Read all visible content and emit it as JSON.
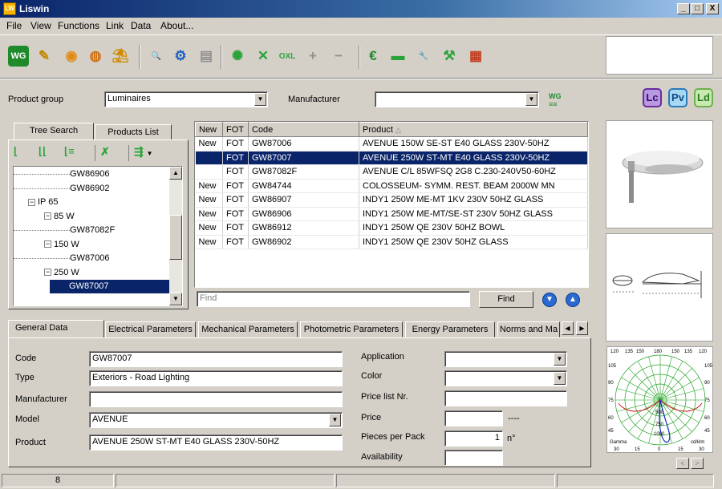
{
  "app": {
    "title": "Liswin",
    "icon_text": "LW"
  },
  "window_buttons": {
    "minimize": "_",
    "maximize": "□",
    "close": "X"
  },
  "menu": [
    "File",
    "View",
    "Functions",
    "Link",
    "Data",
    "About..."
  ],
  "toolbar": [
    {
      "name": "wg-icon",
      "glyph": "WG",
      "color": "#1f8a2a"
    },
    {
      "name": "wand-icon",
      "glyph": "✎",
      "color": "#c08a00"
    },
    {
      "name": "globe-icon",
      "glyph": "◉",
      "color": "#e08a10"
    },
    {
      "name": "globe-search-icon",
      "glyph": "◍",
      "color": "#d07010"
    },
    {
      "name": "presenter-icon",
      "glyph": "⛱",
      "color": "#d08a00"
    },
    {
      "name": "search-icon",
      "glyph": "🔍",
      "color": "#1f5fbf"
    },
    {
      "name": "settings-search-icon",
      "glyph": "⚙",
      "color": "#1f5fbf"
    },
    {
      "name": "document-icon",
      "glyph": "▤",
      "color": "#909090"
    },
    {
      "name": "gear-list-icon",
      "glyph": "✺",
      "color": "#2aa33a"
    },
    {
      "name": "cross-list-icon",
      "glyph": "✕",
      "color": "#2aa33a"
    },
    {
      "name": "oxl-icon",
      "glyph": "OXL",
      "color": "#2aa33a"
    },
    {
      "name": "plus-list-icon",
      "glyph": "+",
      "color": "#909090"
    },
    {
      "name": "minus-list-icon",
      "glyph": "−",
      "color": "#909090"
    },
    {
      "name": "euro-icon",
      "glyph": "€",
      "color": "#1f8a2a"
    },
    {
      "name": "money-icon",
      "glyph": "▬",
      "color": "#2aa33a"
    },
    {
      "name": "wrench-icon",
      "glyph": "🔧",
      "color": "#2aa33a"
    },
    {
      "name": "tools-icon",
      "glyph": "⚒",
      "color": "#2aa33a"
    },
    {
      "name": "abacus-icon",
      "glyph": "▦",
      "color": "#c04020"
    }
  ],
  "filters": {
    "product_group_label": "Product group",
    "product_group_value": "Luminaires",
    "manufacturer_label": "Manufacturer",
    "manufacturer_value": ""
  },
  "badges": {
    "lc": "Lc",
    "pv": "Pv",
    "ld": "Ld"
  },
  "left_tabs": {
    "tree_search": "Tree Search",
    "products_list": "Products List"
  },
  "tree": [
    {
      "indent": 0,
      "text": "GW86906",
      "expander": ""
    },
    {
      "indent": 0,
      "text": "GW86902",
      "expander": ""
    },
    {
      "indent": 1,
      "text": "IP 65",
      "expander": "−"
    },
    {
      "indent": 2,
      "text": "85 W",
      "expander": "−"
    },
    {
      "indent": 3,
      "text": "GW87082F",
      "expander": ""
    },
    {
      "indent": 2,
      "text": "150 W",
      "expander": "−"
    },
    {
      "indent": 3,
      "text": "GW87006",
      "expander": ""
    },
    {
      "indent": 2,
      "text": "250 W",
      "expander": "−"
    },
    {
      "indent": 3,
      "text": "GW87007",
      "expander": "",
      "selected": true
    }
  ],
  "grid": {
    "columns": [
      "New",
      "FOT",
      "Code",
      "Product"
    ],
    "rows": [
      {
        "new": "New",
        "fot": "FOT",
        "code": "GW87006",
        "product": "AVENUE 150W SE-ST E40 GLASS 230V-50HZ"
      },
      {
        "new": "",
        "fot": "FOT",
        "code": "GW87007",
        "product": "AVENUE 250W ST-MT E40 GLASS 230V-50HZ",
        "selected": true
      },
      {
        "new": "",
        "fot": "FOT",
        "code": "GW87082F",
        "product": "AVENUE C/L 85WFSQ 2G8 C.230-240V50-60HZ"
      },
      {
        "new": "New",
        "fot": "FOT",
        "code": "GW84744",
        "product": "COLOSSEUM- SYMM. REST. BEAM 2000W MN"
      },
      {
        "new": "New",
        "fot": "FOT",
        "code": "GW86907",
        "product": "INDY1 250W ME-MT 1KV 230V 50HZ GLASS"
      },
      {
        "new": "New",
        "fot": "FOT",
        "code": "GW86906",
        "product": "INDY1 250W ME-MT/SE-ST 230V 50HZ GLASS"
      },
      {
        "new": "New",
        "fot": "FOT",
        "code": "GW86912",
        "product": "INDY1 250W QE 230V 50HZ BOWL"
      },
      {
        "new": "New",
        "fot": "FOT",
        "code": "GW86902",
        "product": "INDY1 250W QE 230V 50HZ GLASS"
      }
    ]
  },
  "find": {
    "placeholder": "Find",
    "button": "Find"
  },
  "bottom_tabs": [
    "General Data",
    "Electrical Parameters",
    "Mechanical Parameters",
    "Photometric Parameters",
    "Energy Parameters",
    "Norms and Ma"
  ],
  "form": {
    "code_label": "Code",
    "code_value": "GW87007",
    "type_label": "Type",
    "type_value": "Exteriors - Road Lighting",
    "manufacturer_label": "Manufacturer",
    "manufacturer_value": "",
    "model_label": "Model",
    "model_value": "AVENUE",
    "product_label": "Product",
    "product_value": "AVENUE 250W ST-MT E40 GLASS 230V-50HZ",
    "application_label": "Application",
    "application_value": "",
    "color_label": "Color",
    "color_value": "",
    "price_list_label": "Price list Nr.",
    "price_list_value": "",
    "price_label": "Price",
    "price_value": "",
    "price_suffix": "----",
    "pieces_label": "Pieces per Pack",
    "pieces_value": "1",
    "pieces_unit": "n°",
    "availability_label": "Availability",
    "availability_value": ""
  },
  "polar": {
    "top_ticks": [
      "120",
      "135",
      "150",
      "180",
      "150",
      "135",
      "120"
    ],
    "bottom_ticks": [
      "30",
      "15",
      "0",
      "15",
      "30"
    ],
    "left_ticks": [
      "105",
      "90",
      "75",
      "60",
      "45"
    ],
    "right_ticks": [
      "105",
      "90",
      "75",
      "60",
      "45"
    ],
    "radial_labels": [
      "500",
      "750",
      "1000"
    ],
    "corner_left": "Gamma",
    "corner_right": "cd/klm"
  },
  "status": {
    "count": "8"
  }
}
